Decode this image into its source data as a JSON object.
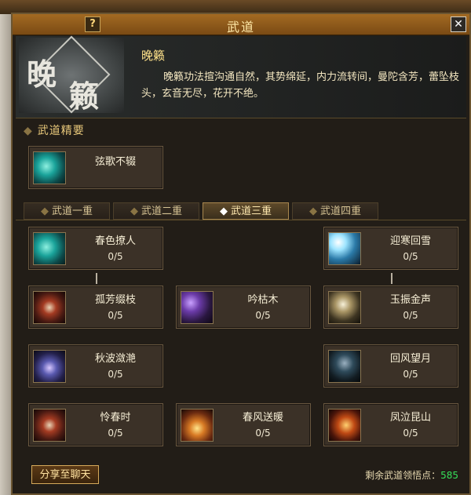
{
  "window": {
    "title": "武道",
    "help_label": "?",
    "close_label": "✕"
  },
  "header": {
    "emblem_glyph_1": "晚",
    "emblem_glyph_2": "籁",
    "skill_name": "晚籁",
    "skill_description": "晚籁功法揎沟通自然，其势绵延，内力流转间，曼陀含芳，蕾坠枝头，玄音无尽，花开不绝。"
  },
  "essentials": {
    "section_title": "武道精要",
    "skill": {
      "name": "弦歌不辍",
      "icon": "teal-blade-icon"
    }
  },
  "tabs": [
    {
      "label": "武道一重",
      "selected": false
    },
    {
      "label": "武道二重",
      "selected": false
    },
    {
      "label": "武道三重",
      "selected": true
    },
    {
      "label": "武道四重",
      "selected": false
    }
  ],
  "skills": [
    {
      "name": "春色撩人",
      "count": "0/5",
      "icon": "teal-blade-icon"
    },
    {
      "name": "迎寒回雪",
      "count": "0/5",
      "icon": "ice-burst-icon"
    },
    {
      "name": "孤芳缀枝",
      "count": "0/5",
      "icon": "red-flower-icon"
    },
    {
      "name": "吟枯木",
      "count": "0/5",
      "icon": "purple-hand-icon"
    },
    {
      "name": "玉振金声",
      "count": "0/5",
      "icon": "gold-strike-icon"
    },
    {
      "name": "秋波潋滟",
      "count": "0/5",
      "icon": "purple-wind-icon"
    },
    {
      "name": "回风望月",
      "count": "0/5",
      "icon": "dark-figure-icon"
    },
    {
      "name": "怜春时",
      "count": "0/5",
      "icon": "red-flower-icon"
    },
    {
      "name": "春风送暖",
      "count": "0/5",
      "icon": "flame-hand-icon"
    },
    {
      "name": "凤泣昆山",
      "count": "0/5",
      "icon": "fire-swirl-icon"
    }
  ],
  "footer": {
    "share_label": "分享至聊天",
    "points_label": "剩余武道领悟点：",
    "points_value": "585"
  },
  "colors": {
    "panel_bg": "#221d17",
    "title_gold": "#ffe28a",
    "points_green": "#36e05a"
  }
}
